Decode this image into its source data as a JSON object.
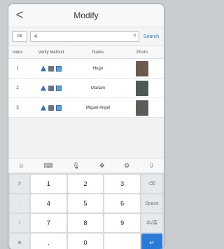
{
  "header": {
    "back_glyph": "<",
    "title": "Modify"
  },
  "search": {
    "scope_label": "All",
    "value": "4",
    "clear_glyph": "×",
    "button_label": "Search"
  },
  "table": {
    "columns": [
      "Index",
      "Verify Method",
      "Name",
      "Photo"
    ],
    "rows": [
      {
        "index": "1",
        "name": "Hugo",
        "photo_color": "#6d5a4f"
      },
      {
        "index": "2",
        "name": "Mariam",
        "photo_color": "#4b5a52"
      },
      {
        "index": "3",
        "name": "Miguel Angel",
        "photo_color": "#5e5a57"
      }
    ]
  },
  "keyboard_toolbar": {
    "icons": [
      "emoji-icon",
      "keyboard-icon",
      "mic-icon",
      "move-icon",
      "settings-icon",
      "hide-keyboard-icon"
    ]
  },
  "keypad": {
    "left": [
      "#",
      "-",
      "/",
      "@",
      "⊕"
    ],
    "keys": [
      "1",
      "2",
      "3",
      "4",
      "5",
      "6",
      "7",
      "8",
      "9",
      ".",
      "0",
      " "
    ],
    "right": [
      "⌫",
      "Space",
      "中/英",
      "↵"
    ]
  },
  "colors": {
    "accent": "#2a7bd8",
    "panel": "#e9ecef",
    "keyboard_bg": "#d7dbde"
  }
}
